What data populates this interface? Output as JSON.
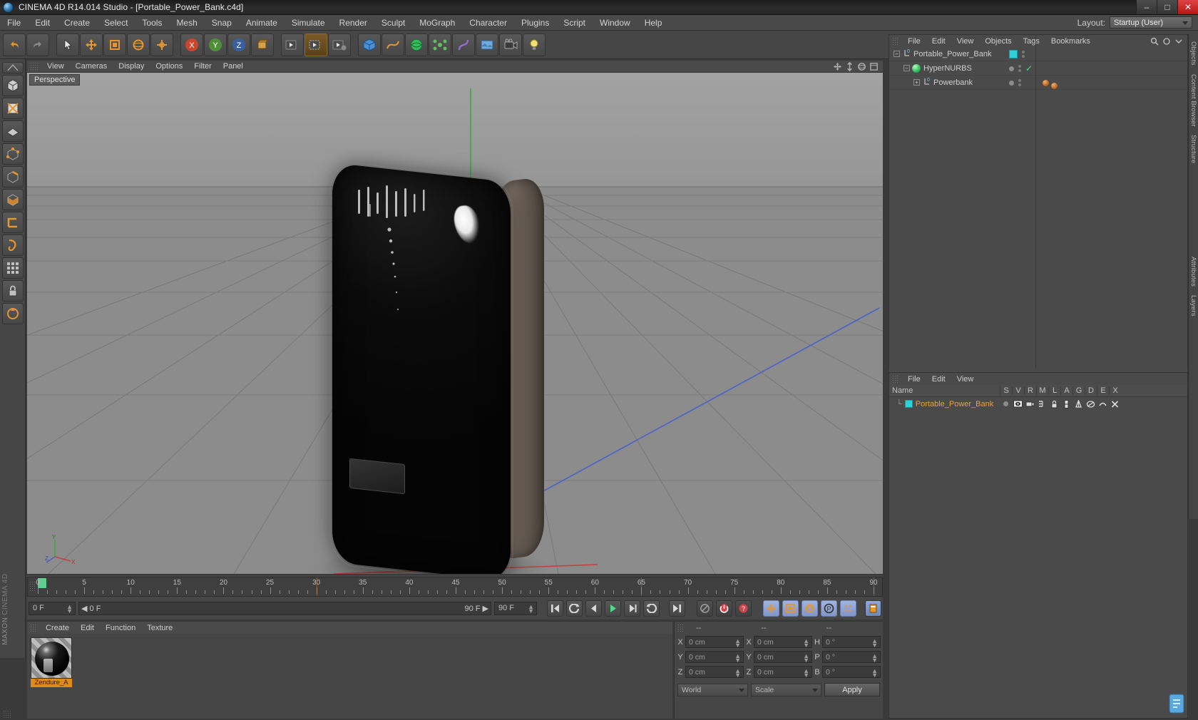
{
  "window": {
    "title": "CINEMA 4D R14.014 Studio - [Portable_Power_Bank.c4d]",
    "minimize": "–",
    "maximize": "□",
    "close": "✕"
  },
  "menubar": {
    "items": [
      "File",
      "Edit",
      "Create",
      "Select",
      "Tools",
      "Mesh",
      "Snap",
      "Animate",
      "Simulate",
      "Render",
      "Sculpt",
      "MoGraph",
      "Character",
      "Plugins",
      "Script",
      "Window",
      "Help"
    ],
    "layout_label": "Layout:",
    "layout_value": "Startup (User)"
  },
  "toolbar": {
    "buttons": [
      {
        "name": "undo-button",
        "label": "Undo"
      },
      {
        "name": "redo-button",
        "label": "Redo"
      },
      {
        "name": "live-selection-tool",
        "label": "Live Selection"
      },
      {
        "name": "move-tool",
        "label": "Move"
      },
      {
        "name": "scale-tool",
        "label": "Scale"
      },
      {
        "name": "rotate-tool",
        "label": "Rotate"
      },
      {
        "name": "world-object-axis-button",
        "label": "World/Object"
      },
      {
        "name": "lock-x-axis-button",
        "label": "X"
      },
      {
        "name": "lock-y-axis-button",
        "label": "Y"
      },
      {
        "name": "lock-z-axis-button",
        "label": "Z"
      },
      {
        "name": "coordinate-system-button",
        "label": "Coordinate System"
      },
      {
        "name": "render-view-button",
        "label": "Render View"
      },
      {
        "name": "render-region-button",
        "label": "Render Region"
      },
      {
        "name": "render-settings-button",
        "label": "Render Settings"
      },
      {
        "name": "add-cube-button",
        "label": "Cube"
      },
      {
        "name": "add-spline-button",
        "label": "Spline"
      },
      {
        "name": "add-hypernurbs-button",
        "label": "HyperNURBS"
      },
      {
        "name": "add-array-button",
        "label": "Array"
      },
      {
        "name": "add-bend-button",
        "label": "Bend"
      },
      {
        "name": "add-scene-button",
        "label": "Scene"
      },
      {
        "name": "add-camera-button",
        "label": "Camera"
      },
      {
        "name": "add-light-button",
        "label": "Light"
      }
    ]
  },
  "left_palette": {
    "buttons": [
      {
        "name": "texture-axis-tool",
        "label": "Texture Axis"
      },
      {
        "name": "model-mode-button",
        "label": "Model Mode"
      },
      {
        "name": "texture-mode-button",
        "label": "Texture Mode"
      },
      {
        "name": "polygon-mode-button",
        "label": "Polygons"
      },
      {
        "name": "point-mode-button",
        "label": "Points"
      },
      {
        "name": "edge-mode-button",
        "label": "Edges"
      },
      {
        "name": "polygon-select-button",
        "label": "Polygon Select"
      },
      {
        "name": "workplane-button",
        "label": "Workplane"
      },
      {
        "name": "snap-tool-button",
        "label": "Snap"
      },
      {
        "name": "grid-button",
        "label": "Grid"
      },
      {
        "name": "lock-button",
        "label": "Lock"
      },
      {
        "name": "enable-axis-button",
        "label": "Enable Axis"
      }
    ],
    "brand_line1": "MAXON",
    "brand_line2": "CINEMA 4D"
  },
  "viewport": {
    "menu_items": [
      "View",
      "Cameras",
      "Display",
      "Options",
      "Filter",
      "Panel"
    ],
    "label": "Perspective",
    "axis_x": "X",
    "axis_y": "Y",
    "axis_z": "Z",
    "corner_icons": [
      "pan-icon",
      "zoom-icon",
      "orbit-icon",
      "maximize-icon"
    ],
    "bg_top_color": "#9a9a9a",
    "bg_bottom_color": "#6a6a6a"
  },
  "timeline": {
    "ticks": [
      0,
      5,
      10,
      15,
      20,
      25,
      30,
      35,
      40,
      45,
      50,
      55,
      60,
      65,
      70,
      75,
      80,
      85,
      90
    ],
    "frame_min": 0,
    "frame_max": 90,
    "current_frame": 0,
    "current_frame_label": "0 F",
    "range_start_label": "0 F",
    "range_end_label": "90 F",
    "end_field_label": "90 F",
    "frame_display": "0 F",
    "playhead_color": "#5ecf8e",
    "transport": [
      {
        "name": "go-to-start-button",
        "glyph": "start"
      },
      {
        "name": "previous-key-button",
        "glyph": "prevkey"
      },
      {
        "name": "step-back-button",
        "glyph": "stepback"
      },
      {
        "name": "play-button",
        "glyph": "play"
      },
      {
        "name": "step-forward-button",
        "glyph": "stepfwd"
      },
      {
        "name": "next-key-button",
        "glyph": "nextkey"
      },
      {
        "name": "go-to-end-button",
        "glyph": "end"
      }
    ],
    "record_tools": [
      {
        "name": "autokey-button"
      },
      {
        "name": "record-active-objects-button"
      },
      {
        "name": "keyframe-selection-button"
      }
    ],
    "anim_toggles": [
      {
        "name": "record-position-button",
        "label": "Position"
      },
      {
        "name": "record-scale-button",
        "label": "Scale"
      },
      {
        "name": "record-rotation-button",
        "label": "Rotation"
      },
      {
        "name": "record-parameter-button",
        "label": "P"
      },
      {
        "name": "record-pla-button",
        "label": "PLA"
      },
      {
        "name": "timeline-settings-button",
        "label": "Settings"
      }
    ]
  },
  "material_manager": {
    "menu_items": [
      "Create",
      "Edit",
      "Function",
      "Texture"
    ],
    "materials": [
      {
        "name": "Zendure_A",
        "selected": true,
        "accent": "#e08a1e"
      }
    ]
  },
  "coordinates_manager": {
    "headers": [
      "--",
      "--",
      "--"
    ],
    "rows": [
      {
        "axis1": "X",
        "value1": "0 cm",
        "axis2": "X",
        "value2": "0 cm",
        "axis3": "H",
        "value3": "0 °"
      },
      {
        "axis1": "Y",
        "value1": "0 cm",
        "axis2": "Y",
        "value2": "0 cm",
        "axis3": "P",
        "value3": "0 °"
      },
      {
        "axis1": "Z",
        "value1": "0 cm",
        "axis2": "Z",
        "value2": "0 cm",
        "axis3": "B",
        "value3": "0 °"
      }
    ],
    "system_select": "World",
    "mode_select": "Scale",
    "apply_label": "Apply"
  },
  "object_manager": {
    "menu_items": [
      "File",
      "Edit",
      "View",
      "Objects",
      "Tags",
      "Bookmarks"
    ],
    "objects": [
      {
        "name": "Portable_Power_Bank",
        "type": "null",
        "depth": 0,
        "expanded": true,
        "layer_color": "#2ed2d6",
        "has_check": false,
        "tags": []
      },
      {
        "name": "HyperNURBS",
        "type": "hypernurbs",
        "depth": 1,
        "expanded": true,
        "layer_color": null,
        "has_check": true,
        "tags": []
      },
      {
        "name": "Powerbank",
        "type": "null",
        "depth": 2,
        "expanded": false,
        "layer_color": null,
        "has_check": false,
        "tags": [
          "material-tag",
          "material-tag"
        ]
      }
    ]
  },
  "layer_manager": {
    "menu_items": [
      "File",
      "Edit",
      "View"
    ],
    "columns": [
      "Name",
      "S",
      "V",
      "R",
      "M",
      "L",
      "A",
      "G",
      "D",
      "E",
      "X"
    ],
    "rows": [
      {
        "name": "Portable_Power_Bank",
        "color": "#2ed2d6",
        "text_color": "#e8a13c"
      }
    ]
  },
  "right_dock": {
    "tabs": [
      "Objects",
      "Content Browser",
      "Structure",
      "Attributes",
      "Layers"
    ]
  }
}
